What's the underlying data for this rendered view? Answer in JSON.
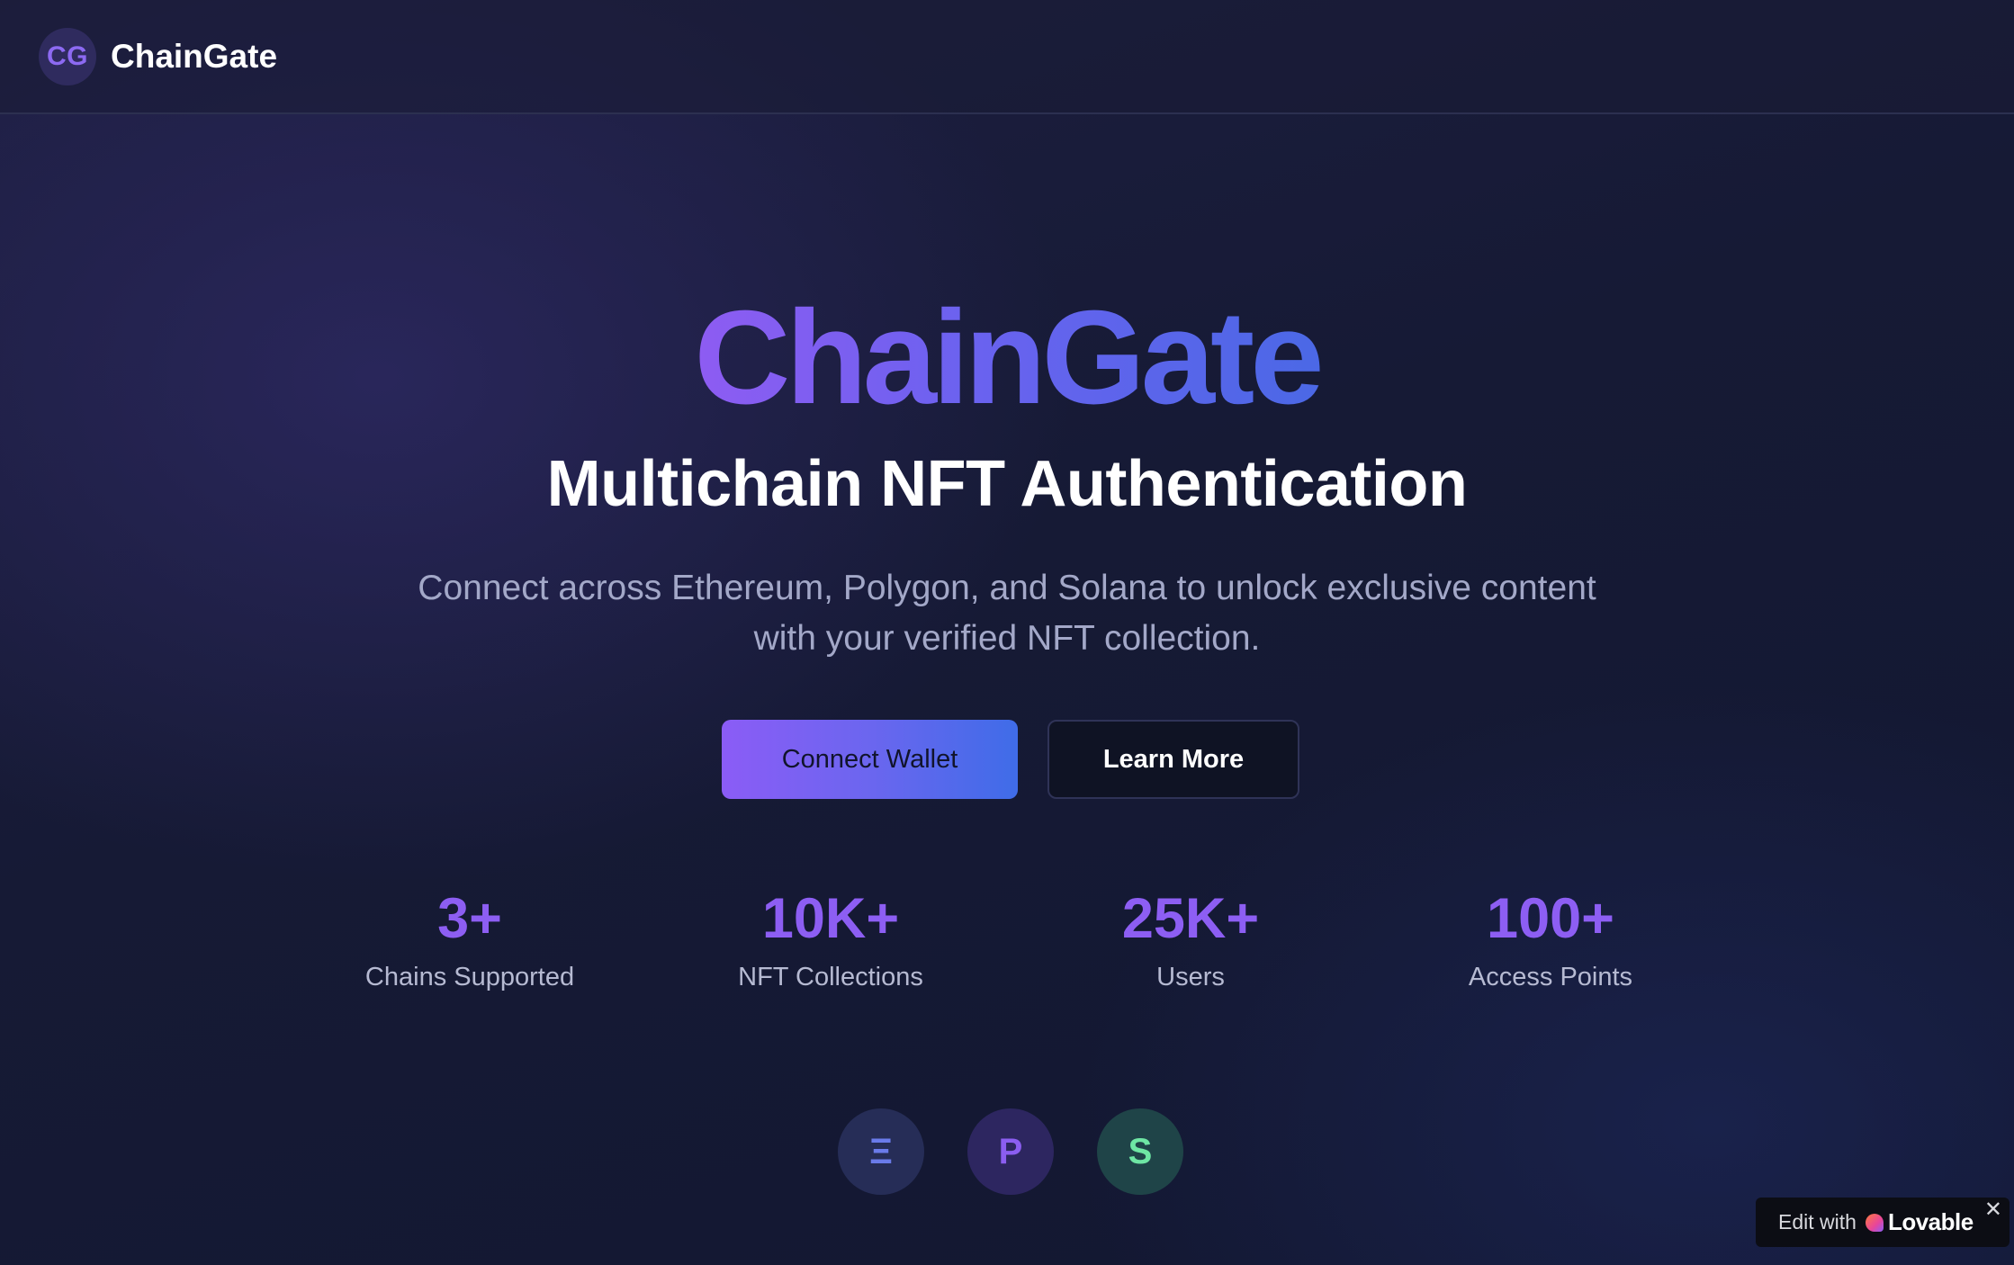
{
  "header": {
    "logo_initials": "CG",
    "brand_name": "ChainGate"
  },
  "hero": {
    "title": "ChainGate",
    "subtitle": "Multichain NFT Authentication",
    "description_line1": "Connect across Ethereum, Polygon, and Solana to unlock exclusive content",
    "description_line2": "with your verified NFT collection."
  },
  "buttons": {
    "connect_label": "Connect Wallet",
    "learn_label": "Learn More"
  },
  "stats": [
    {
      "value": "3+",
      "label": "Chains Supported"
    },
    {
      "value": "10K+",
      "label": "NFT Collections"
    },
    {
      "value": "25K+",
      "label": "Users"
    },
    {
      "value": "100+",
      "label": "Access Points"
    }
  ],
  "chains": [
    {
      "symbol": "Ξ",
      "icon": "ethereum-icon",
      "color": "#6a7bea"
    },
    {
      "symbol": "P",
      "icon": "polygon-icon",
      "color": "#8b5ef0"
    },
    {
      "symbol": "S",
      "icon": "solana-icon",
      "color": "#6ee6a4"
    }
  ],
  "lovable_badge": {
    "prefix": "Edit with",
    "name": "Lovable",
    "close": "✕"
  },
  "colors": {
    "accent_purple": "#8d5ef3",
    "accent_blue": "#4b68e6",
    "background": "#161a35"
  }
}
